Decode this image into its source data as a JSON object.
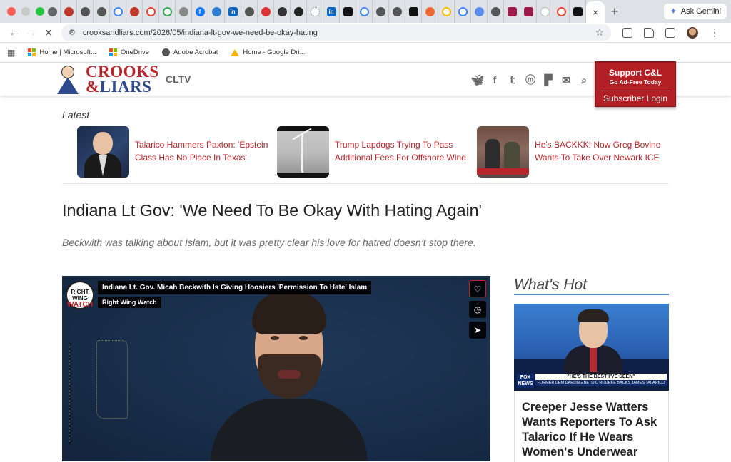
{
  "browser": {
    "active_tab_close": "×",
    "new_tab": "+",
    "gemini_label": "Ask Gemini",
    "url": "crooksandliars.com/2026/05/indiana-lt-gov-we-need-be-okay-hating",
    "bookmarks": [
      {
        "label": "Home | Microsoft..."
      },
      {
        "label": "OneDrive"
      },
      {
        "label": "Adobe Acrobat"
      },
      {
        "label": "Home - Google Dri..."
      }
    ]
  },
  "site": {
    "logo_line1": "CROOKS",
    "logo_amp": "&",
    "logo_line2": "LIARS",
    "cltv": "CLTV",
    "support_title": "Support C&L",
    "support_subtitle": "Go Ad-Free Today",
    "subscriber_login": "Subscriber Login"
  },
  "latest": {
    "label": "Latest",
    "items": [
      {
        "title": "Talarico Hammers Paxton: 'Epstein Class Has No Place In Texas'"
      },
      {
        "title": "Trump Lapdogs Trying To Pass Additional Fees For Offshore Wind"
      },
      {
        "title": "He's BACKKK! Now Greg Bovino Wants To Take Over Newark ICE"
      }
    ]
  },
  "article": {
    "headline": "Indiana Lt Gov: 'We Need To Be Okay With Hating Again'",
    "dek": "Beckwith was talking about Islam, but it was pretty clear his love for hatred doesn’t stop there.",
    "video": {
      "logo_top": "RIGHT WING",
      "logo_bottom": "WATCH",
      "title": "Indiana Lt. Gov. Micah Beckwith Is Giving Hoosiers 'Permission To Hate' Islam",
      "channel": "Right Wing Watch"
    }
  },
  "sidebar": {
    "heading": "What's Hot",
    "image_network": "FOX NEWS",
    "image_chyron": "\"HE'S THE BEST I'VE SEEN\"",
    "image_chyron_sub": "FORMER DEM DARLING BETO O'ROURKE BACKS JAMES TALARICO",
    "top_story": "Creeper Jesse Watters Wants Reporters To Ask Talarico If He Wears Women's Underwear"
  },
  "colors": {
    "brand_red": "#b8242a",
    "brand_blue": "#2d4a8c",
    "support_bg": "#b21f24",
    "hot_rule": "#5a8fc8"
  }
}
